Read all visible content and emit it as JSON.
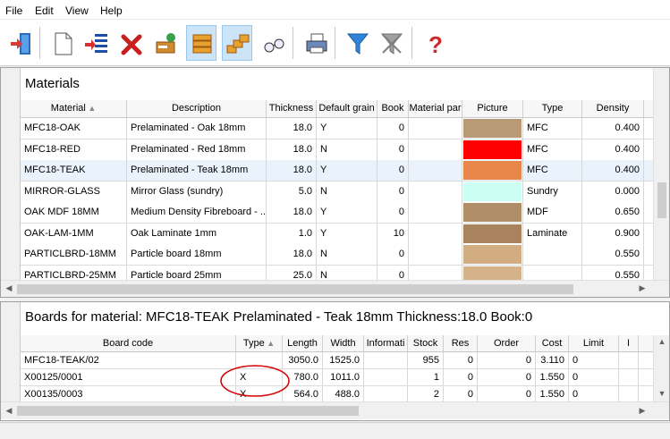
{
  "menu": [
    "File",
    "Edit",
    "View",
    "Help"
  ],
  "toolbar": {
    "buttons": [
      {
        "name": "exit-icon"
      },
      {
        "name": "new-document-icon"
      },
      {
        "name": "list-arrow-icon"
      },
      {
        "name": "delete-icon"
      },
      {
        "name": "recycle-icon"
      },
      {
        "name": "boards-stack-icon"
      },
      {
        "name": "offcuts-icon"
      },
      {
        "name": "glasses-icon"
      },
      {
        "name": "print-icon"
      },
      {
        "name": "filter-icon"
      },
      {
        "name": "clear-filter-icon"
      },
      {
        "name": "help-icon"
      }
    ]
  },
  "materials": {
    "title": "Materials",
    "columns": [
      "Material",
      "Description",
      "Thickness",
      "Default grain",
      "Book",
      "Material par",
      "Picture",
      "Type",
      "Density"
    ],
    "sort_column": "Material",
    "rows": [
      {
        "material": "MFC18-OAK",
        "description": "Prelaminated - Oak 18mm",
        "thickness": "18.0",
        "grain": "Y",
        "book": "0",
        "par": "",
        "picture": "#b89a76",
        "type": "MFC",
        "density": "0.400"
      },
      {
        "material": "MFC18-RED",
        "description": "Prelaminated - Red 18mm",
        "thickness": "18.0",
        "grain": "N",
        "book": "0",
        "par": "",
        "picture": "#ff0000",
        "type": "MFC",
        "density": "0.400"
      },
      {
        "material": "MFC18-TEAK",
        "description": "Prelaminated - Teak 18mm",
        "thickness": "18.0",
        "grain": "Y",
        "book": "0",
        "par": "",
        "picture": "#e8874a",
        "type": "MFC",
        "density": "0.400",
        "selected": true
      },
      {
        "material": "MIRROR-GLASS",
        "description": "Mirror Glass (sundry)",
        "thickness": "5.0",
        "grain": "N",
        "book": "0",
        "par": "",
        "picture": "#ccfff4",
        "type": "Sundry",
        "density": "0.000"
      },
      {
        "material": "OAK MDF 18MM",
        "description": "Medium Density Fibreboard - ...",
        "thickness": "18.0",
        "grain": "Y",
        "book": "0",
        "par": "",
        "picture": "#b08e68",
        "type": "MDF",
        "density": "0.650"
      },
      {
        "material": "OAK-LAM-1MM",
        "description": "Oak Laminate 1mm",
        "thickness": "1.0",
        "grain": "Y",
        "book": "10",
        "par": "",
        "picture": "#a9835e",
        "type": "Laminate",
        "density": "0.900"
      },
      {
        "material": "PARTICLBRD-18MM",
        "description": "Particle board 18mm",
        "thickness": "18.0",
        "grain": "N",
        "book": "0",
        "par": "",
        "picture": "#d2ad82",
        "type": "",
        "density": "0.550"
      },
      {
        "material": "PARTICLBRD-25MM",
        "description": "Particle board 25mm",
        "thickness": "25.0",
        "grain": "N",
        "book": "0",
        "par": "",
        "picture": "#d6b28a",
        "type": "",
        "density": "0.550"
      }
    ]
  },
  "boards": {
    "title": "Boards for material: MFC18-TEAK Prelaminated - Teak 18mm Thickness:18.0 Book:0",
    "columns": [
      "Board code",
      "Type",
      "Length",
      "Width",
      "Informati",
      "Stock",
      "Res",
      "Order",
      "Cost",
      "Limit",
      "I"
    ],
    "sort_column": "Type",
    "rows": [
      {
        "code": "MFC18-TEAK/02",
        "type": "",
        "length": "3050.0",
        "width": "1525.0",
        "info": "",
        "stock": "955",
        "res": "0",
        "order": "0",
        "cost": "3.110",
        "limit": "0"
      },
      {
        "code": "X00125/0001",
        "type": "X",
        "length": "780.0",
        "width": "1011.0",
        "info": "",
        "stock": "1",
        "res": "0",
        "order": "0",
        "cost": "1.550",
        "limit": "0"
      },
      {
        "code": "X00135/0003",
        "type": "X",
        "length": "564.0",
        "width": "488.0",
        "info": "",
        "stock": "2",
        "res": "0",
        "order": "0",
        "cost": "1.550",
        "limit": "0"
      }
    ]
  },
  "annotation_color": "#d40000"
}
